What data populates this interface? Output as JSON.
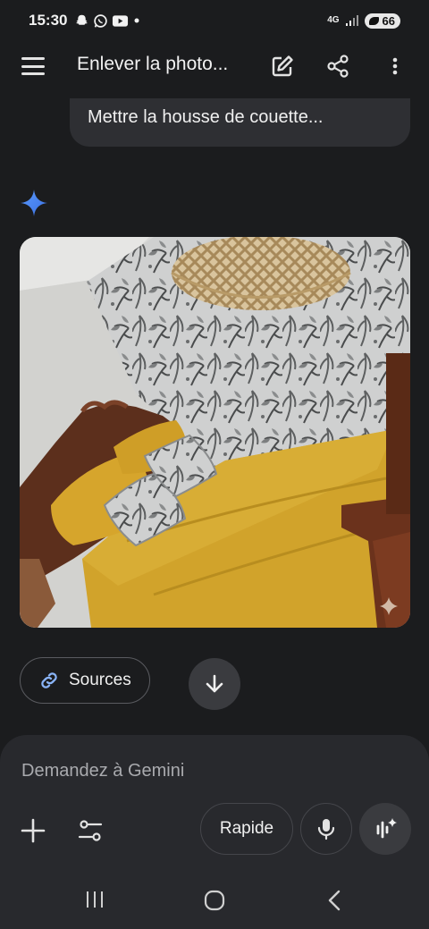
{
  "status_bar": {
    "time": "15:30",
    "network": "4G",
    "battery": "66",
    "icons": [
      "snapchat-icon",
      "whatsapp-icon",
      "youtube-icon",
      "notification-dot-icon",
      "signal-icon",
      "battery-icon"
    ]
  },
  "top_bar": {
    "title": "Enlever la photo...",
    "icons": [
      "menu-icon",
      "edit-icon",
      "share-icon",
      "more-vert-icon"
    ]
  },
  "chat": {
    "user_message": "Mettre la housse de couette...",
    "response_icon": "gemini-spark-icon",
    "image_description_icon": "generated-image"
  },
  "actions": {
    "sources_label": "Sources",
    "sources_icon": "link-icon",
    "scroll_icon": "arrow-down-icon"
  },
  "composer": {
    "placeholder": "Demandez à Gemini",
    "mode_label": "Rapide",
    "icons": [
      "plus-icon",
      "tools-icon",
      "mic-icon",
      "live-icon"
    ]
  },
  "nav_bar": {
    "icons": [
      "recent-apps-icon",
      "home-icon",
      "back-icon"
    ]
  },
  "colors": {
    "background": "#1b1c1e",
    "bubble": "#2e2f33",
    "composer": "#28292d",
    "spark": "#4c8df6",
    "sheet": "#d4a72c"
  }
}
